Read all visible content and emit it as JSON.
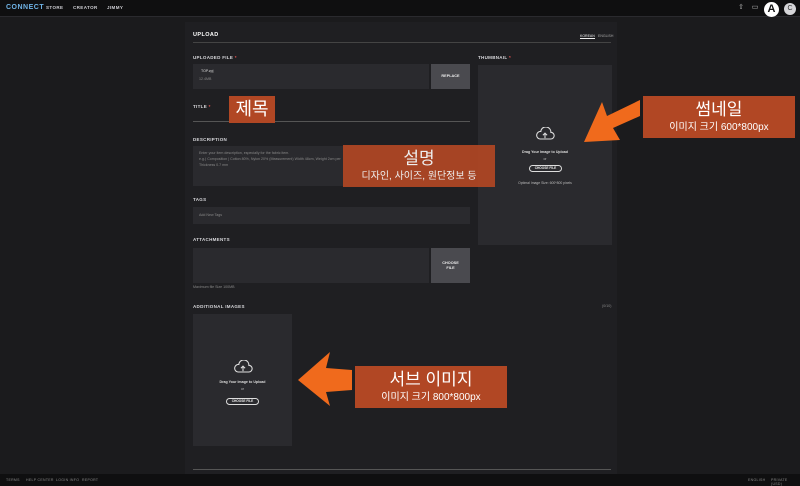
{
  "header": {
    "logo": "CONNECT",
    "nav": [
      "STORE",
      "CREATOR",
      "JIMMY"
    ],
    "avatar_letter": "A",
    "avatar2_letter": "C"
  },
  "page": {
    "title": "UPLOAD",
    "lang_tabs": [
      "KOREAN",
      "ENGLISH"
    ]
  },
  "form": {
    "uploaded_file_label": "UPLOADED FILE",
    "file_name": "TOP.zpj",
    "file_size": "12.4MB",
    "replace_label": "REPLACE",
    "title_label": "TITLE",
    "description_label": "DESCRIPTION",
    "description_placeholder_1": "Enter your item description, especially for the fabric item.",
    "description_placeholder_2": "e.g.) Composition | Cotton 80%, Nylon 20% (Measurement) Width 48cm, Weight 2cm per",
    "description_placeholder_3": "Thickness 0.7 mm",
    "tags_label": "TAGS",
    "tags_placeholder": "Add New Tags",
    "attachments_label": "ATTACHMENTS",
    "choose_file_label": "CHOOSE FILE",
    "max_file_size": "Maximum file Size 100MB",
    "additional_images_label": "ADDITIONAL IMAGES",
    "additional_count": "(0/10)",
    "thumbnail_label": "THUMBNAIL"
  },
  "upload_zone": {
    "drag_text": "Drag Your Image to Upload",
    "or_text": "or",
    "choose_text": "CHOOSE FILE",
    "thumb_hint": "Optimal Image Size: 600*800 pixels"
  },
  "annotations": {
    "title_note": "제목",
    "desc_title": "설명",
    "desc_sub": "디자인, 사이즈, 원단정보 등",
    "thumb_title": "썸네일",
    "thumb_sub": "이미지 크기 600*800px",
    "sub_title": "서브 이미지",
    "sub_sub": "이미지 크기 800*800px"
  },
  "footer": {
    "links": [
      "TERMS",
      "HELP CENTER",
      "LOGIN INFO",
      "REPORT"
    ],
    "lang": "ENGLISH",
    "currency": "PRIVATE (USD)"
  },
  "colors": {
    "accent": "#6fb3e6",
    "annotation": "#b14724",
    "arrow": "#f06a1c",
    "required": "#e55555"
  }
}
